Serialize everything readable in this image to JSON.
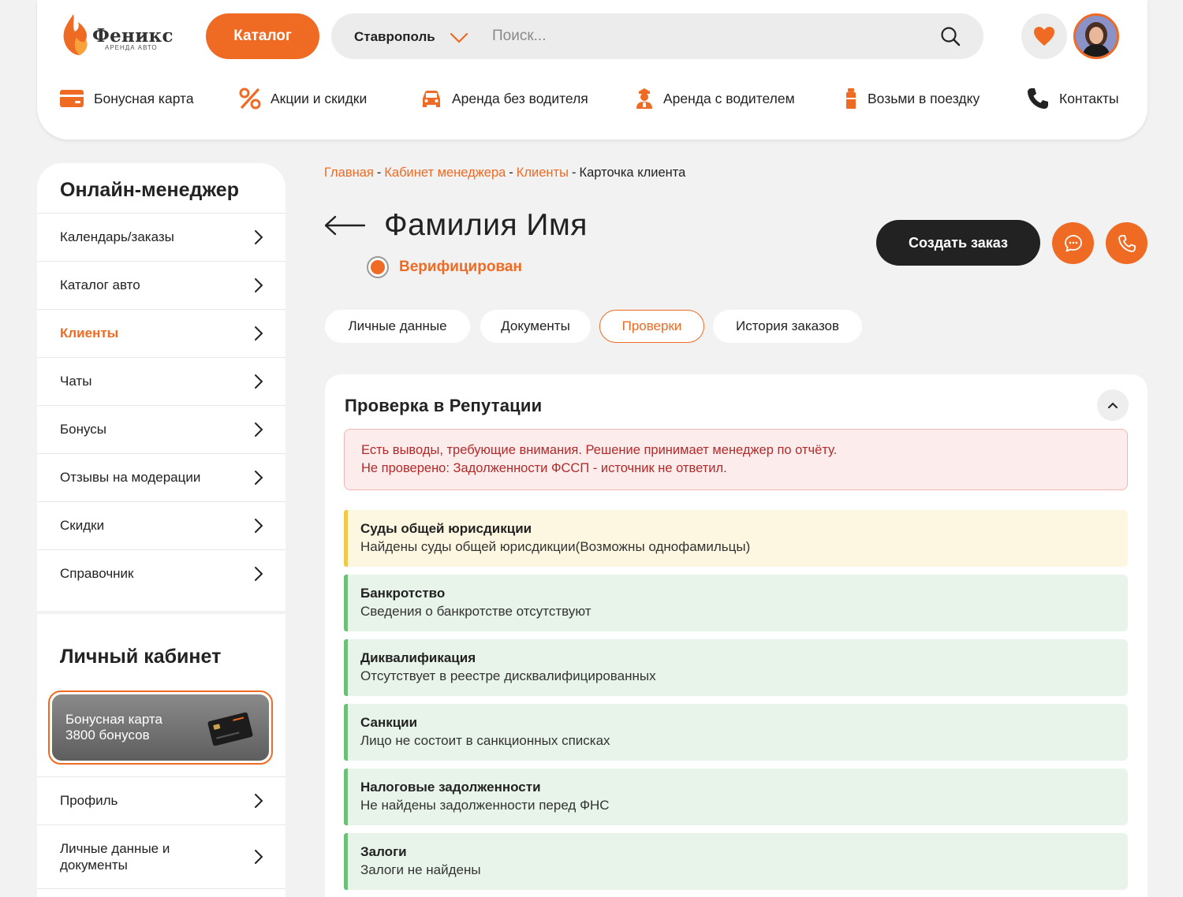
{
  "header": {
    "logo_name": "Феникс",
    "logo_sub": "АРЕНДА АВТО",
    "catalog_label": "Каталог",
    "city": "Ставрополь",
    "search_placeholder": "Поиск...",
    "nav": [
      {
        "label": "Бонусная карта",
        "icon": "card-icon"
      },
      {
        "label": "Акции и скидки",
        "icon": "percent-icon"
      },
      {
        "label": "Аренда без водителя",
        "icon": "car-icon"
      },
      {
        "label": "Аренда с водителем",
        "icon": "driver-icon"
      },
      {
        "label": "Возьми в поездку",
        "icon": "bottle-icon"
      },
      {
        "label": "Контакты",
        "icon": "phone-icon"
      }
    ]
  },
  "sidebar": {
    "title": "Онлайн-менеджер",
    "items": [
      {
        "label": "Календарь/заказы"
      },
      {
        "label": "Каталог авто"
      },
      {
        "label": "Клиенты"
      },
      {
        "label": "Чаты"
      },
      {
        "label": "Бонусы"
      },
      {
        "label": "Отзывы на модерации"
      },
      {
        "label": "Скидки"
      },
      {
        "label": "Справочник"
      }
    ],
    "active_item": "Клиенты",
    "account_title": "Личный кабинет",
    "bonus_card_line1": "Бонусная карта",
    "bonus_card_line2": "3800 бонусов",
    "account_items": [
      {
        "label": "Профиль"
      },
      {
        "label": "Личные данные и документы"
      }
    ]
  },
  "breadcrumb": {
    "home": "Главная",
    "manager": "Кабинет менеджера",
    "clients": "Клиенты",
    "current": "Карточка клиента",
    "separator": "-"
  },
  "client": {
    "name": "Фамилия Имя",
    "status": "Верифицирован"
  },
  "actions": {
    "create_order": "Создать заказ"
  },
  "tabs": [
    {
      "label": "Личные данные"
    },
    {
      "label": "Документы"
    },
    {
      "label": "Проверки"
    },
    {
      "label": "История заказов"
    }
  ],
  "active_tab": "Проверки",
  "panel": {
    "title": "Проверка в Репутации",
    "alert_line1": "Есть выводы, требующие внимания. Решение принимает менеджер по отчёту.",
    "alert_line2": "Не проверено: Задолженности ФССП - источник не ответил.",
    "checks": [
      {
        "title": "Суды общей юрисдикции",
        "desc": "Найдены суды общей юрисдикции(Возможны однофамильцы)",
        "status": "warning"
      },
      {
        "title": "Банкротство",
        "desc": "Сведения о банкротстве отсутствуют",
        "status": "ok"
      },
      {
        "title": "Диквалификация",
        "desc": "Отсутствует в реестре дисквалифицированных",
        "status": "ok"
      },
      {
        "title": "Санкции",
        "desc": "Лицо не состоит в санкционных списках",
        "status": "ok"
      },
      {
        "title": "Налоговые задолженности",
        "desc": "Не найдены задолженности перед ФНС",
        "status": "ok"
      },
      {
        "title": "Залоги",
        "desc": "Залоги не найдены",
        "status": "ok"
      }
    ]
  },
  "colors": {
    "accent": "#ef6a22",
    "dark": "#222222",
    "alert_text": "#b22a2a",
    "warning_bar": "#f0c84a",
    "ok_bar": "#6fbf7a"
  }
}
